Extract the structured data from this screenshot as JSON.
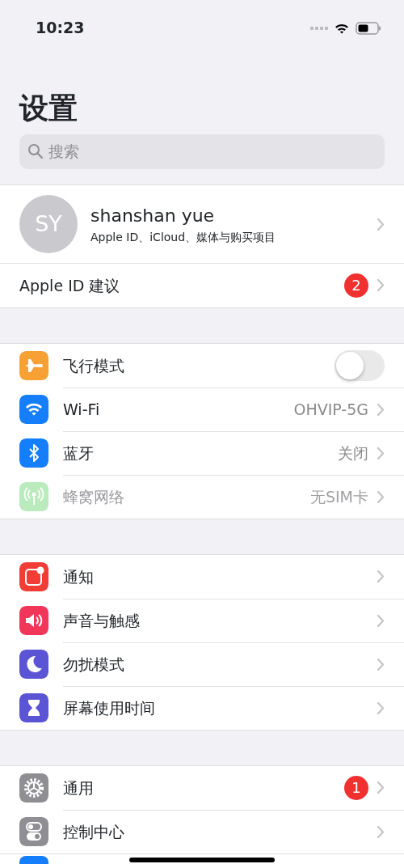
{
  "status_bar": {
    "time": "10:23"
  },
  "title": "设置",
  "search": {
    "placeholder": "搜索"
  },
  "profile": {
    "initials": "SY",
    "name": "shanshan yue",
    "subtitle": "Apple ID、iCloud、媒体与购买项目",
    "suggestion": {
      "label": "Apple ID 建议",
      "badge": "2"
    }
  },
  "groups": [
    {
      "rows": [
        {
          "kind": "toggle",
          "label": "飞行模式",
          "on": false,
          "disabled": false
        },
        {
          "kind": "link",
          "label": "Wi-Fi",
          "value": "OHVIP-5G",
          "disabled": false
        },
        {
          "kind": "link",
          "label": "蓝牙",
          "value": "关闭",
          "disabled": false
        },
        {
          "kind": "link",
          "label": "蜂窝网络",
          "value": "无SIM卡",
          "disabled": true
        }
      ]
    },
    {
      "rows": [
        {
          "kind": "link",
          "label": "通知",
          "disabled": false
        },
        {
          "kind": "link",
          "label": "声音与触感",
          "disabled": false
        },
        {
          "kind": "link",
          "label": "勿扰模式",
          "disabled": false
        },
        {
          "kind": "link",
          "label": "屏幕使用时间",
          "disabled": false
        }
      ]
    },
    {
      "rows": [
        {
          "kind": "link",
          "label": "通用",
          "badge": "1",
          "disabled": false
        },
        {
          "kind": "link",
          "label": "控制中心",
          "disabled": false
        }
      ]
    }
  ]
}
